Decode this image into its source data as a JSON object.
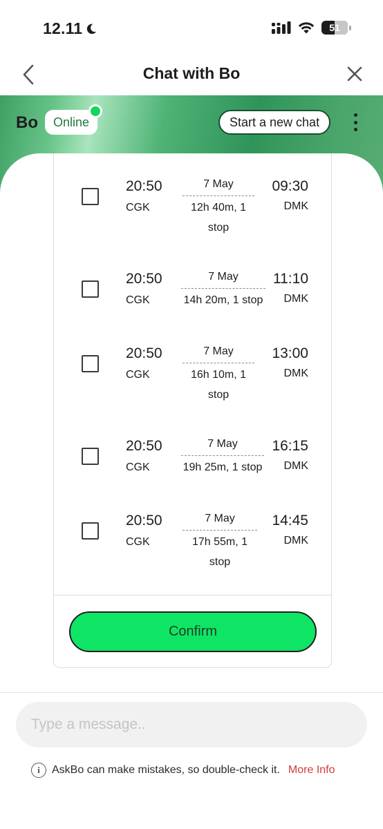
{
  "status_bar": {
    "time": "12.11",
    "battery": "51",
    "battery_level": 0.51
  },
  "nav": {
    "title": "Chat with Bo"
  },
  "banner": {
    "agent_name": "Bo",
    "status": "Online",
    "new_chat_label": "Start a new chat"
  },
  "flights": [
    {
      "dep_time": "20:50",
      "dep_code": "CGK",
      "date": "7 May",
      "duration": "12h 40m, 1 stop",
      "arr_time": "09:30",
      "arr_code": "DMK"
    },
    {
      "dep_time": "20:50",
      "dep_code": "CGK",
      "date": "7 May",
      "duration": "14h 20m, 1 stop",
      "arr_time": "11:10",
      "arr_code": "DMK"
    },
    {
      "dep_time": "20:50",
      "dep_code": "CGK",
      "date": "7 May",
      "duration": "16h 10m, 1 stop",
      "arr_time": "13:00",
      "arr_code": "DMK"
    },
    {
      "dep_time": "20:50",
      "dep_code": "CGK",
      "date": "7 May",
      "duration": "19h 25m, 1 stop",
      "arr_time": "16:15",
      "arr_code": "DMK"
    },
    {
      "dep_time": "20:50",
      "dep_code": "CGK",
      "date": "7 May",
      "duration": "17h 55m, 1 stop",
      "arr_time": "14:45",
      "arr_code": "DMK"
    }
  ],
  "confirm_label": "Confirm",
  "input": {
    "placeholder": "Type a message.."
  },
  "disclaimer": {
    "text": "AskBo can make mistakes, so double-check it.",
    "link": "More Info"
  },
  "colors": {
    "accent_green": "#0fe564",
    "online_dot": "#12d660",
    "link_red": "#d43a3a"
  }
}
